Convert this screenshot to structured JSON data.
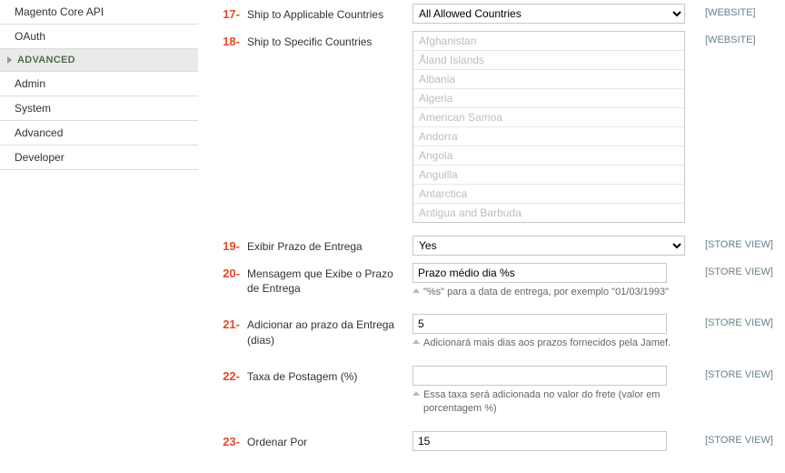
{
  "sidebar": {
    "items_top": [
      {
        "label": "Magento Core API"
      },
      {
        "label": "OAuth"
      }
    ],
    "section_header": "ADVANCED",
    "items_bottom": [
      {
        "label": "Admin"
      },
      {
        "label": "System"
      },
      {
        "label": "Advanced"
      },
      {
        "label": "Developer"
      }
    ]
  },
  "scopes": {
    "website": "[WEBSITE]",
    "storeview": "[STORE VIEW]"
  },
  "rows": {
    "r17": {
      "marker": "17-",
      "label": "Ship to Applicable Countries",
      "value": "All Allowed Countries",
      "scope": "website"
    },
    "r18": {
      "marker": "18-",
      "label": "Ship to Specific Countries",
      "scope": "website",
      "options": [
        "Afghanistan",
        "Åland Islands",
        "Albania",
        "Algeria",
        "American Samoa",
        "Andorra",
        "Angola",
        "Anguilla",
        "Antarctica",
        "Antigua and Barbuda"
      ]
    },
    "r19": {
      "marker": "19-",
      "label": "Exibir Prazo de Entrega",
      "value": "Yes",
      "scope": "storeview"
    },
    "r20": {
      "marker": "20-",
      "label": "Mensagem que Exibe o Prazo de Entrega",
      "value": "Prazo médio dia %s",
      "note": "\"%s\" para a data de entrega, por exemplo \"01/03/1993\"",
      "scope": "storeview"
    },
    "r21": {
      "marker": "21-",
      "label": "Adicionar ao prazo da Entrega (dias)",
      "value": "5",
      "note": "Adicionará mais dias aos prazos fornecidos pela Jamef.",
      "scope": "storeview"
    },
    "r22": {
      "marker": "22-",
      "label": "Taxa de Postagem (%)",
      "value": "",
      "note": "Essa taxa será adicionada no valor do frete (valor em porcentagem %)",
      "scope": "storeview"
    },
    "r23": {
      "marker": "23-",
      "label": "Ordenar Por",
      "value": "15",
      "scope": "storeview"
    }
  }
}
